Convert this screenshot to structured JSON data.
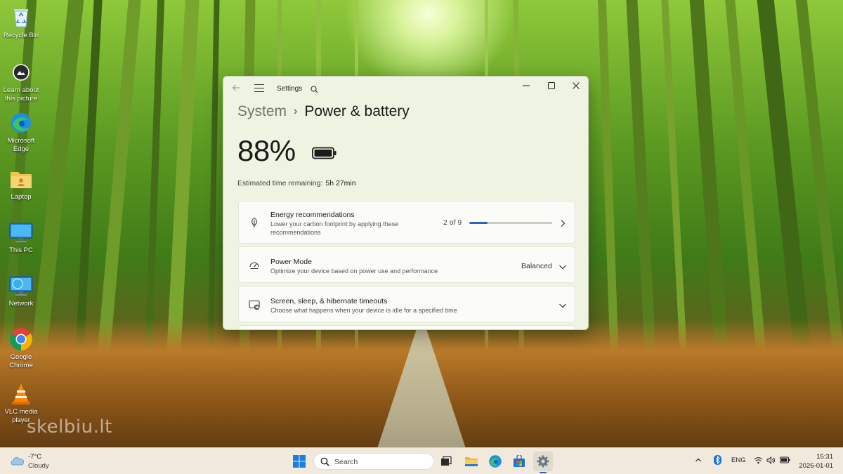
{
  "desktop": {
    "icons": [
      {
        "label": "Recycle Bin",
        "icon": "recycle-bin-icon"
      },
      {
        "label": "Learn about this picture",
        "icon": "camera-icon"
      },
      {
        "label": "Microsoft Edge",
        "icon": "edge-icon"
      },
      {
        "label": "Laptop",
        "icon": "folder-icon"
      },
      {
        "label": "This PC",
        "icon": "monitor-icon"
      },
      {
        "label": "Network",
        "icon": "network-icon"
      },
      {
        "label": "Google Chrome",
        "icon": "chrome-icon"
      },
      {
        "label": "VLC media player",
        "icon": "vlc-icon"
      }
    ],
    "watermark": "skelbiu.lt"
  },
  "window": {
    "app_title": "Settings",
    "breadcrumb": {
      "parent": "System",
      "separator": "›",
      "current": "Power & battery"
    },
    "battery": {
      "percent": "88%",
      "remaining_label": "Estimated time remaining:",
      "remaining_value": "5h 27min"
    },
    "energy": {
      "title": "Energy recommendations",
      "subtitle": "Lower your carbon footprint by applying these recommendations",
      "count": "2 of 9",
      "progress_fraction": 0.22
    },
    "power_mode": {
      "title": "Power Mode",
      "subtitle": "Optimize your device based on power use and performance",
      "value": "Balanced"
    },
    "screen_sleep": {
      "title": "Screen, sleep, & hibernate timeouts",
      "subtitle": "Choose what happens when your device is idle for a specified time"
    }
  },
  "taskbar": {
    "weather": {
      "temp": "-7°C",
      "condition": "Cloudy"
    },
    "search_placeholder": "Search",
    "tray": {
      "language": "ENG"
    },
    "clock": {
      "time": "15:31",
      "date": "2026-01-01"
    }
  },
  "colors": {
    "accent": "#2a63c6",
    "window_bg": "#eef4e1",
    "card_bg": "#fbfcf8",
    "taskbar_bg": "#f1e9dc"
  }
}
